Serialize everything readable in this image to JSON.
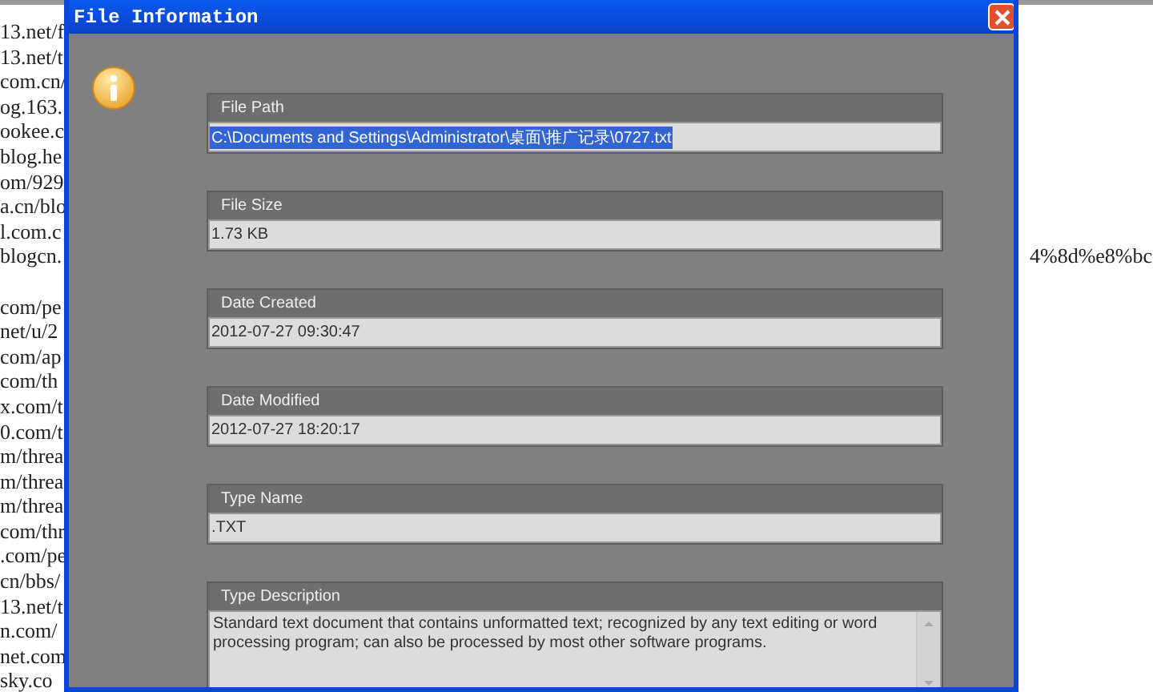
{
  "background_page": {
    "blocks": [
      [
        {
          "text": "13.net/f"
        },
        {
          "text": "13.net/t"
        },
        {
          "text": "com.cn/"
        },
        {
          "text": "og.163."
        },
        {
          "text": "ookee.c"
        },
        {
          "text": "blog.he"
        },
        {
          "text": "om/929"
        },
        {
          "text": "a.cn/blo"
        },
        {
          "text": "l.com.c"
        },
        {
          "text": "blogcn.",
          "tail": "4%8d%e8%bc"
        }
      ],
      [
        {
          "text": "com/pe"
        },
        {
          "text": "net/u/2"
        },
        {
          "text": "com/ap"
        },
        {
          "text": "com/th"
        },
        {
          "text": "x.com/t"
        },
        {
          "text": "0.com/t"
        },
        {
          "text": "m/threa"
        },
        {
          "text": "m/threa"
        },
        {
          "text": "m/threa"
        },
        {
          "text": "com/thr"
        },
        {
          "text": ".com/pe"
        },
        {
          "text": "cn/bbs/"
        },
        {
          "text": "13.net/t"
        },
        {
          "text": "n.com/"
        },
        {
          "text": "net.com"
        },
        {
          "text": "sky.co"
        }
      ]
    ]
  },
  "window": {
    "title": "File Information"
  },
  "fields": [
    {
      "kind": "line",
      "label": "File Path",
      "value": "C:\\Documents and Settings\\Administrator\\桌面\\推广记录\\0727.txt",
      "selected": true
    },
    {
      "kind": "line",
      "label": "File Size",
      "value": "1.73 KB",
      "selected": false
    },
    {
      "kind": "line",
      "label": "Date Created",
      "value": "2012-07-27 09:30:47",
      "selected": false
    },
    {
      "kind": "line",
      "label": "Date Modified",
      "value": "2012-07-27 18:20:17",
      "selected": false
    },
    {
      "kind": "line",
      "label": "Type Name",
      "value": ".TXT",
      "selected": false
    },
    {
      "kind": "multiline",
      "label": "Type Description",
      "value": "Standard text document that contains unformatted text; recognized by any text editing or word processing program; can also be processed by most other software programs.",
      "selected": false
    }
  ]
}
